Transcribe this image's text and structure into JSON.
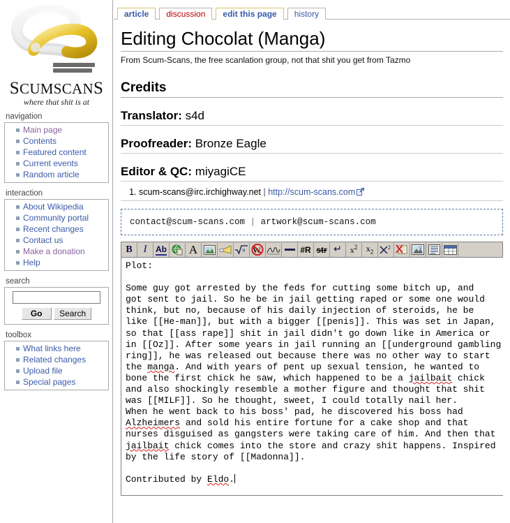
{
  "site": {
    "brand_name": "ScumScans",
    "brand_tagline": "where that shit is at",
    "logo_icon": "scumscans-swirl-logo"
  },
  "sidebar": {
    "navigation": {
      "heading": "navigation",
      "items": [
        {
          "label": "Main page",
          "visited": true
        },
        {
          "label": "Contents",
          "visited": false
        },
        {
          "label": "Featured content",
          "visited": false
        },
        {
          "label": "Current events",
          "visited": false
        },
        {
          "label": "Random article",
          "visited": false
        }
      ]
    },
    "interaction": {
      "heading": "interaction",
      "items": [
        {
          "label": "About Wikipedia",
          "visited": false
        },
        {
          "label": "Community portal",
          "visited": false
        },
        {
          "label": "Recent changes",
          "visited": false
        },
        {
          "label": "Contact us",
          "visited": false
        },
        {
          "label": "Make a donation",
          "visited": true
        },
        {
          "label": "Help",
          "visited": false
        }
      ]
    },
    "search": {
      "heading": "search",
      "input_value": "",
      "input_placeholder": "",
      "go_label": "Go",
      "search_label": "Search"
    },
    "toolbox": {
      "heading": "toolbox",
      "items": [
        {
          "label": "What links here",
          "visited": false
        },
        {
          "label": "Related changes",
          "visited": false
        },
        {
          "label": "Upload file",
          "visited": false
        },
        {
          "label": "Special pages",
          "visited": false
        }
      ]
    }
  },
  "tabs": [
    {
      "label": "article",
      "state": "article"
    },
    {
      "label": "discussion",
      "state": "newpage"
    },
    {
      "label": "edit this page",
      "state": "selected"
    },
    {
      "label": "history",
      "state": "normal"
    }
  ],
  "page": {
    "title": "Editing Chocolat (Manga)",
    "subtitle": "From Scum-Scans, the free scanlation group, not that shit you get from Tazmo",
    "credits_heading": "Credits",
    "credits": [
      {
        "role": "Translator:",
        "name": "s4d"
      },
      {
        "role": "Proofreader:",
        "name": "Bronze Eagle"
      },
      {
        "role": "Editor & QC:",
        "name": "miyagiCE"
      }
    ],
    "contact_list": [
      {
        "number": "1.",
        "irc": "scum-scans@irc.irchighway.net",
        "separator": "|",
        "url_label": "http://scum-scans.com",
        "url_icon": "external-link-icon"
      }
    ],
    "contact_box": {
      "email_primary": "contact@scum-scans.com",
      "separator": "|",
      "email_artwork": "artwork@scum-scans.com"
    }
  },
  "toolbar": {
    "buttons": [
      {
        "name": "bold-button",
        "glyph": "B",
        "kind": "bold",
        "title": "Bold text"
      },
      {
        "name": "italic-button",
        "glyph": "I",
        "kind": "italic",
        "title": "Italic text"
      },
      {
        "name": "internal-link-button",
        "glyph": "Ab",
        "kind": "ab",
        "title": "Internal link"
      },
      {
        "name": "external-link-button",
        "glyph": "",
        "kind": "globe",
        "title": "External link"
      },
      {
        "name": "headline-button",
        "glyph": "A",
        "kind": "biga",
        "title": "Level 2 headline"
      },
      {
        "name": "embedded-image-button",
        "glyph": "",
        "kind": "image",
        "title": "Embedded image"
      },
      {
        "name": "media-file-button",
        "glyph": "",
        "kind": "horn",
        "title": "Media file link"
      },
      {
        "name": "math-formula-button",
        "glyph": "√n",
        "kind": "math",
        "title": "Mathematical formula"
      },
      {
        "name": "nowiki-button",
        "glyph": "W",
        "kind": "nowiki",
        "title": "Ignore wiki formatting"
      },
      {
        "name": "signature-button",
        "glyph": "",
        "kind": "signature",
        "title": "Your signature with timestamp"
      },
      {
        "name": "horizontal-rule-button",
        "glyph": "—",
        "kind": "hr",
        "title": "Horizontal line"
      },
      {
        "name": "redirect-button",
        "glyph": "#R",
        "kind": "hash",
        "title": "Redirect"
      },
      {
        "name": "strikethrough-button",
        "glyph": "str",
        "kind": "strike",
        "title": "Strike"
      },
      {
        "name": "line-break-button",
        "glyph": "↵",
        "kind": "enter",
        "title": "Line break"
      },
      {
        "name": "superscript-button",
        "glyph": "x2",
        "kind": "sup",
        "title": "Superscript"
      },
      {
        "name": "subscript-button",
        "glyph": "x2",
        "kind": "sub",
        "title": "Subscript"
      },
      {
        "name": "small-text-button",
        "glyph": "x2",
        "kind": "xcross",
        "title": "Small text"
      },
      {
        "name": "hide-comment-button",
        "glyph": "",
        "kind": "comment",
        "title": "Insert hidden comment"
      },
      {
        "name": "picture-gallery-button",
        "glyph": "",
        "kind": "gallery",
        "title": "Insert a picture gallery"
      },
      {
        "name": "block-quote-button",
        "glyph": "",
        "kind": "blockquote",
        "title": "Insert block of quoted text"
      },
      {
        "name": "insert-table-button",
        "glyph": "",
        "kind": "table",
        "title": "Insert a table"
      }
    ]
  },
  "editor": {
    "textarea_name": "wpTextbox1",
    "content": "Plot:\n\nSome guy got arrested by the feds for cutting some bitch up, and\ngot sent to jail. So he be in jail getting raped or some one would\nthink, but no, because of his daily injection of steroids, he be\nlike [[He-man]], but with a bigger [[penis]]. This was set in Japan,\nso that [[ass rape]] shit in jail didn't go down like in America or\nin [[Oz]]. After some years in jail running an [[underground gambling\nring]], he was released out because there was no other way to start\nthe manga. And with years of pent up sexual tension, he wanted to\nbone the first chick he saw, which happened to be a jailbait chick\nand also shockingly resemble a mother figure and thought that shit\nwas [[MILF]]. So he thought, sweet, I could totally nail her.\nWhen he went back to his boss' pad, he discovered his boss had\nAlzheimers and sold his entire fortune for a cake shop and that\nnurses disguised as gangsters were taking care of him. And then that\njailbait chick comes into the store and crazy shit happens. Inspired\nby the life story of [[Madonna]].\n\nContributed by Eldo.",
    "misspelled_words": [
      "manga",
      "jailbait",
      "Alzheimers",
      "Eldo"
    ],
    "caret_after": "Contributed by Eldo."
  },
  "colors": {
    "link": "#3a5aa8",
    "link_visited": "#8a62a0",
    "link_new": "#ba0000",
    "tab_selected_border": "#d8c36a",
    "toolbar_bg": "#d4d0c8",
    "rule": "#aaaaaa",
    "spellcheck_underline": "#d42020"
  }
}
